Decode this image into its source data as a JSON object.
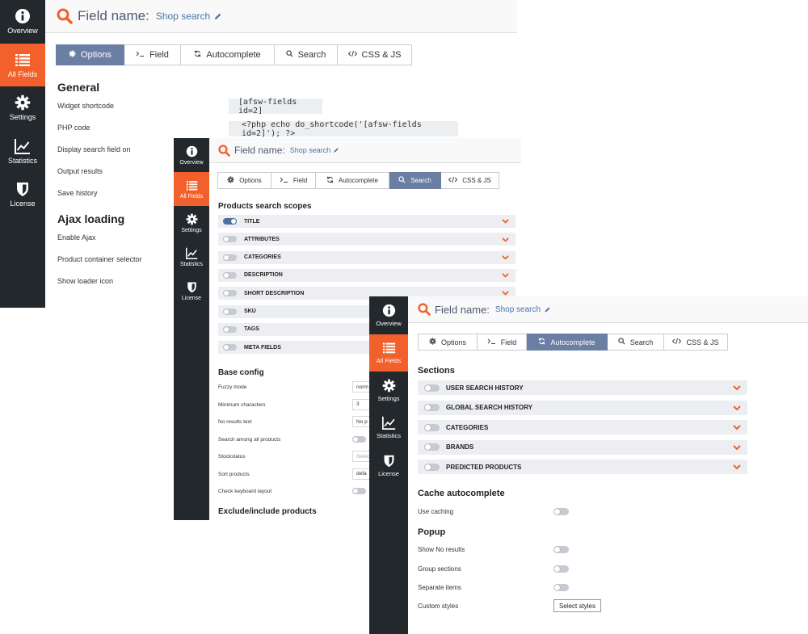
{
  "colors": {
    "sidebar": "#23282d",
    "accent": "#f2602b",
    "tab_active": "#6b7ea3",
    "toggle_on": "#4e6ea5"
  },
  "panel1": {
    "sidebar": [
      {
        "label": "Overview",
        "icon": "info-icon"
      },
      {
        "label": "All Fields",
        "icon": "list-icon",
        "active": true
      },
      {
        "label": "Settings",
        "icon": "gear-icon"
      },
      {
        "label": "Statistics",
        "icon": "chart-icon"
      },
      {
        "label": "License",
        "icon": "shield-icon"
      }
    ],
    "header": {
      "label": "Field name:",
      "value": "Shop search"
    },
    "tabs": [
      {
        "label": "Options",
        "icon": "gear-icon",
        "active": true
      },
      {
        "label": "Field",
        "icon": "terminal-icon"
      },
      {
        "label": "Autocomplete",
        "icon": "refresh-icon"
      },
      {
        "label": "Search",
        "icon": "search-icon"
      },
      {
        "label": "CSS & JS",
        "icon": "code-icon"
      }
    ],
    "general_title": "General",
    "rows": [
      "Widget shortcode",
      "PHP code",
      "Display search field on",
      "Output results",
      "Save history"
    ],
    "shortcode": "[afsw-fields id=2]",
    "php_code": "<?php echo do_shortcode('[afsw-fields id=2]'); ?>",
    "ajax_title": "Ajax loading",
    "ajax_rows": [
      "Enable Ajax",
      "Product container selector",
      "Show loader icon"
    ]
  },
  "panel2": {
    "sidebar": [
      {
        "label": "Overview",
        "icon": "info-icon"
      },
      {
        "label": "All Fields",
        "icon": "list-icon",
        "active": true
      },
      {
        "label": "Settings",
        "icon": "gear-icon"
      },
      {
        "label": "Statistics",
        "icon": "chart-icon"
      },
      {
        "label": "License",
        "icon": "shield-icon"
      }
    ],
    "header": {
      "label": "Field name:",
      "value": "Shop search"
    },
    "tabs": [
      {
        "label": "Options",
        "icon": "gear-icon"
      },
      {
        "label": "Field",
        "icon": "terminal-icon"
      },
      {
        "label": "Autocomplete",
        "icon": "refresh-icon"
      },
      {
        "label": "Search",
        "icon": "search-icon",
        "active": true
      },
      {
        "label": "CSS & JS",
        "icon": "code-icon"
      }
    ],
    "scopes_title": "Products search scopes",
    "scopes": [
      {
        "label": "TITLE",
        "on": true
      },
      {
        "label": "ATTRIBUTES",
        "on": false
      },
      {
        "label": "CATEGORIES",
        "on": false
      },
      {
        "label": "DESCRIPTION",
        "on": false
      },
      {
        "label": "SHORT DESCRIPTION",
        "on": false
      },
      {
        "label": "SKU",
        "on": false
      },
      {
        "label": "TAGS",
        "on": false
      },
      {
        "label": "META FIELDS",
        "on": false
      }
    ],
    "base_title": "Base config",
    "base_rows": [
      {
        "label": "Fuzzy mode",
        "value": "norm"
      },
      {
        "label": "Minimum characters",
        "value": "3"
      },
      {
        "label": "No results text",
        "value": "No p"
      },
      {
        "label": "Search among all products",
        "toggle": false
      },
      {
        "label": "Stockstatus",
        "placeholder": "Selec"
      },
      {
        "label": "Sort products",
        "value": "defa"
      },
      {
        "label": "Check keyboard layout",
        "toggle": false
      }
    ],
    "exclude_title": "Exclude/include products"
  },
  "panel3": {
    "sidebar": [
      {
        "label": "Overview",
        "icon": "info-icon"
      },
      {
        "label": "All Fields",
        "icon": "list-icon",
        "active": true
      },
      {
        "label": "Settings",
        "icon": "gear-icon"
      },
      {
        "label": "Statistics",
        "icon": "chart-icon"
      },
      {
        "label": "License",
        "icon": "shield-icon"
      }
    ],
    "header": {
      "label": "Field name:",
      "value": "Shop search"
    },
    "tabs": [
      {
        "label": "Options",
        "icon": "gear-icon"
      },
      {
        "label": "Field",
        "icon": "terminal-icon"
      },
      {
        "label": "Autocomplete",
        "icon": "refresh-icon",
        "active": true
      },
      {
        "label": "Search",
        "icon": "search-icon"
      },
      {
        "label": "CSS & JS",
        "icon": "code-icon"
      }
    ],
    "sections_title": "Sections",
    "sections": [
      {
        "label": "USER SEARCH HISTORY",
        "on": false
      },
      {
        "label": "GLOBAL SEARCH HISTORY",
        "on": false
      },
      {
        "label": "CATEGORIES",
        "on": false
      },
      {
        "label": "BRANDS",
        "on": false
      },
      {
        "label": "PREDICTED PRODUCTS",
        "on": false
      }
    ],
    "cache_title": "Cache autocomplete",
    "cache_rows": [
      {
        "label": "Use caching",
        "toggle": false
      }
    ],
    "popup_title": "Popup",
    "popup_rows": [
      {
        "label": "Show No results",
        "toggle": false
      },
      {
        "label": "Group sections",
        "toggle": false
      },
      {
        "label": "Separate items",
        "toggle": false
      }
    ],
    "custom_styles_label": "Custom styles",
    "select_styles_button": "Select styles"
  }
}
